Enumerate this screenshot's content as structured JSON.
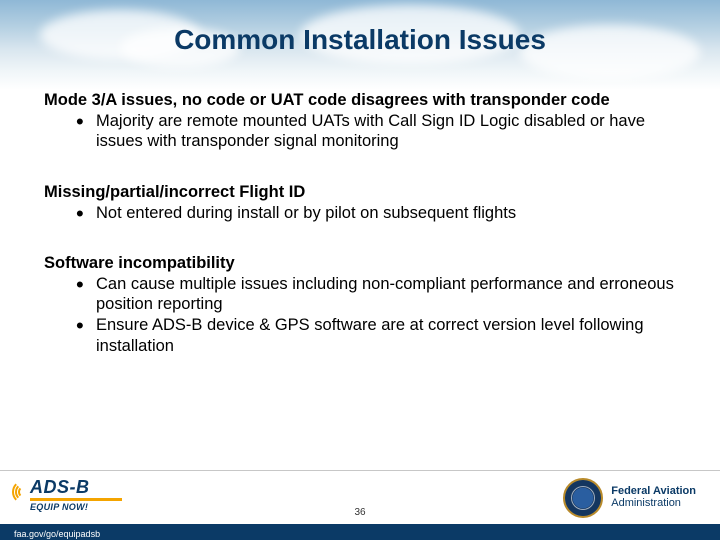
{
  "title": "Common Installation Issues",
  "sections": [
    {
      "heading": "Mode 3/A issues, no code or UAT code disagrees with transponder code",
      "bullets": [
        "Majority are remote mounted UATs with Call Sign ID Logic disabled or have issues with transponder signal monitoring"
      ]
    },
    {
      "heading": "Missing/partial/incorrect Flight ID",
      "bullets": [
        "Not entered during install or by pilot on subsequent flights"
      ]
    },
    {
      "heading": "Software incompatibility",
      "bullets": [
        "Can cause multiple issues including non-compliant performance and erroneous position reporting",
        "Ensure ADS-B device & GPS software are at correct version level following installation"
      ]
    }
  ],
  "footer": {
    "page_number": "36",
    "adsb_main": "ADS-B",
    "adsb_sub": "EQUIP NOW!",
    "url": "faa.gov/go/equipadsb",
    "faa_line1": "Federal Aviation",
    "faa_line2": "Administration"
  }
}
